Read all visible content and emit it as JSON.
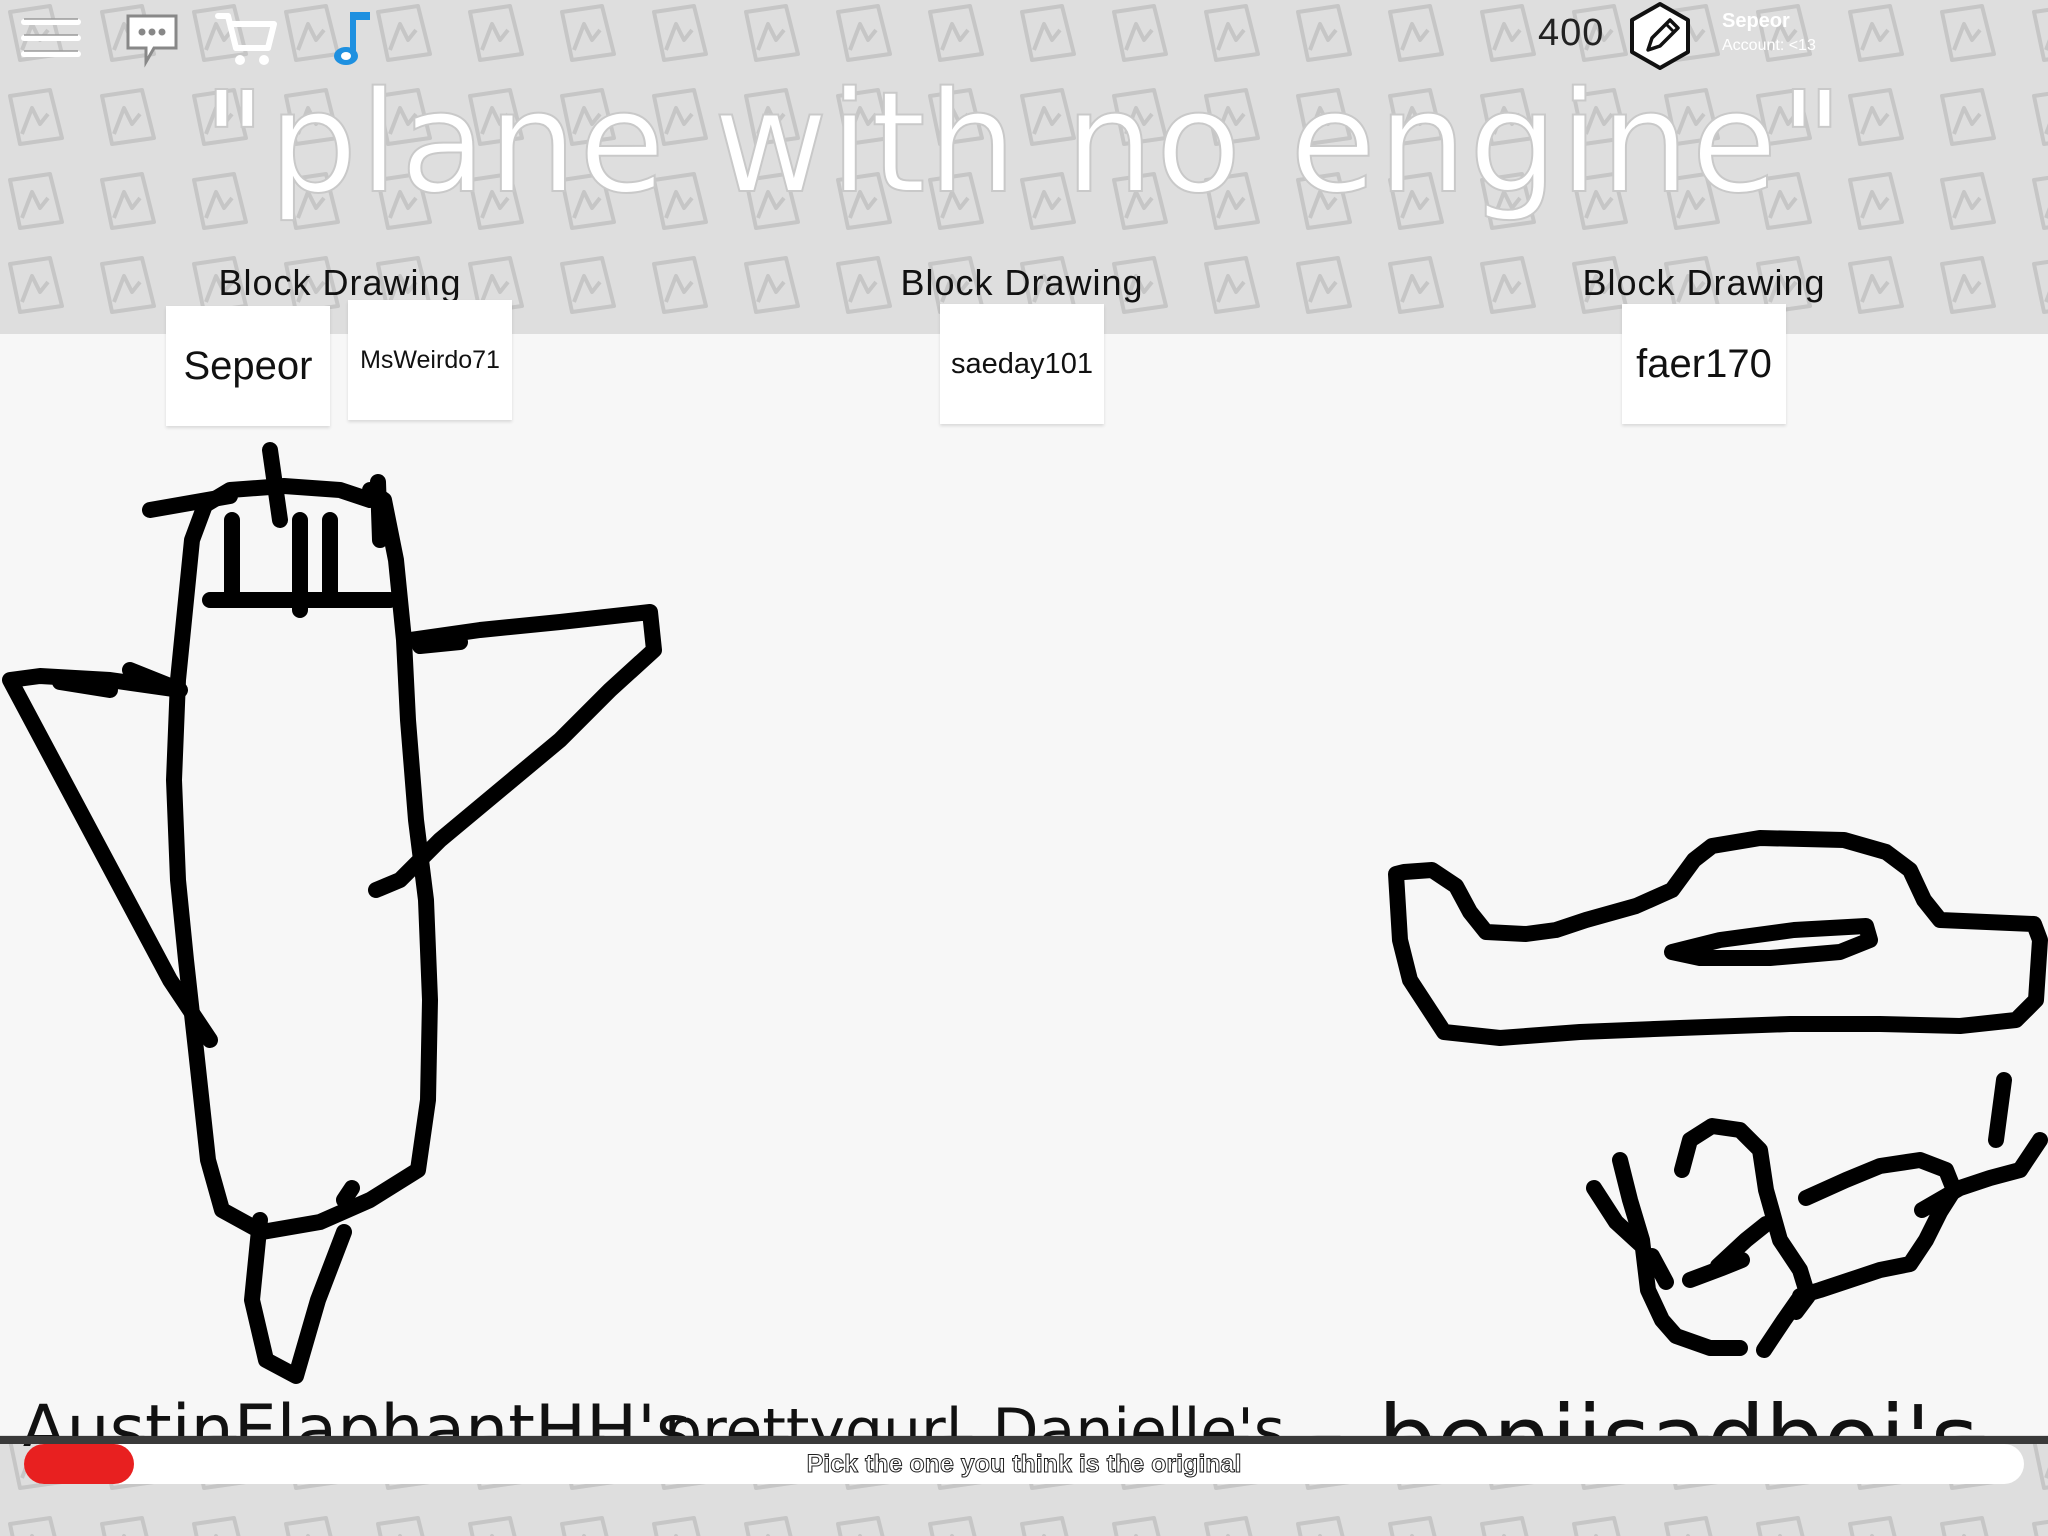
{
  "topbar": {
    "menu_icon": "hamburger-menu-icon",
    "chat_icon": "chat-bubble-icon",
    "shop_icon": "shopping-cart-icon",
    "music_icon": "music-note-icon",
    "coins": "400",
    "pencil_icon": "pencil-badge-icon",
    "username": "Sepeor",
    "account": "Account: <13"
  },
  "prompt": "\"plane with no engine\"",
  "columns": [
    {
      "label": "Block Drawing",
      "players": [
        "Sepeor",
        "MsWeirdo71"
      ]
    },
    {
      "label": "Block Drawing",
      "players": [
        "saeday101"
      ]
    },
    {
      "label": "Block Drawing",
      "players": [
        "faer170"
      ]
    }
  ],
  "choices": [
    "AustinElaphantHH's",
    "prettygurl_Danielle's",
    "benjisadboi's"
  ],
  "status": "Pick the one you think is the original",
  "progress": 0.055,
  "colors": {
    "accent_blue": "#1e90e0",
    "progress_red": "#e82020"
  }
}
